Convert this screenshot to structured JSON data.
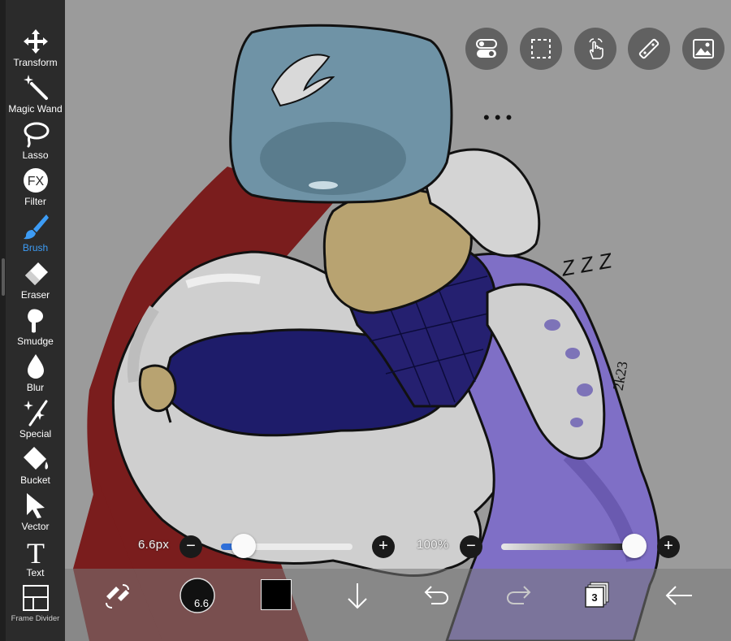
{
  "toolbar": {
    "tools": [
      {
        "label": "Transform",
        "icon": "transform-icon"
      },
      {
        "label": "Magic Wand",
        "icon": "magic-wand-icon"
      },
      {
        "label": "Lasso",
        "icon": "lasso-icon"
      },
      {
        "label": "Filter",
        "icon": "fx-filter-icon",
        "glyph": "FX"
      },
      {
        "label": "Brush",
        "icon": "brush-icon",
        "active": true
      },
      {
        "label": "Eraser",
        "icon": "eraser-icon"
      },
      {
        "label": "Smudge",
        "icon": "smudge-icon"
      },
      {
        "label": "Blur",
        "icon": "blur-drop-icon"
      },
      {
        "label": "Special",
        "icon": "special-icon"
      },
      {
        "label": "Bucket",
        "icon": "bucket-icon"
      },
      {
        "label": "Vector",
        "icon": "vector-arrow-icon"
      },
      {
        "label": "Text",
        "icon": "text-icon",
        "glyph": "T"
      },
      {
        "label": "Frame Divider",
        "icon": "frame-divider-icon"
      }
    ],
    "active_color": "#3d9cf5"
  },
  "top_buttons": [
    {
      "name": "toggle-settings-button",
      "icon": "toggle-icon"
    },
    {
      "name": "selection-button",
      "icon": "dashed-selection-icon"
    },
    {
      "name": "gesture-button",
      "icon": "touch-hand-icon"
    },
    {
      "name": "ruler-button",
      "icon": "ruler-icon"
    },
    {
      "name": "reference-image-button",
      "icon": "image-icon"
    }
  ],
  "brush_controls": {
    "size_label": "6.6px",
    "size_level": 0.17,
    "opacity_label": "100%",
    "opacity_level": 1.0,
    "minus": "−",
    "plus": "+"
  },
  "bottom_bar": {
    "brush_size_badge": "6.6",
    "layers_count": "3",
    "primary_color": "#000000",
    "icons": [
      "swap-tools-icon",
      "brush-size-preview-icon",
      "color-swatch-icon",
      "download-arrow-icon",
      "undo-icon",
      "redo-icon",
      "layers-icon",
      "back-arrow-icon"
    ]
  },
  "canvas": {
    "ellipsis": "• • •",
    "zzz": "Z Z Z",
    "signature": "2k23"
  },
  "colors": {
    "canvas_bg": "#9b9b9b",
    "red_cloak": "#7a1d1d",
    "visor": "#6f93a6",
    "navy_sleeve": "#1e1c6a",
    "purple_suit": "#7f6fc6",
    "white_suit": "#cfcfcf",
    "tan_head": "#b8a371"
  }
}
